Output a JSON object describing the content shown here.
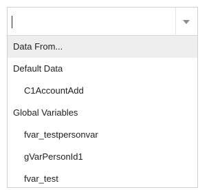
{
  "combobox": {
    "input_value": "",
    "items": [
      {
        "label": "Data From...",
        "level": 0,
        "highlighted": true
      },
      {
        "label": "Default Data",
        "level": 0,
        "highlighted": false
      },
      {
        "label": "C1AccountAdd",
        "level": 1,
        "highlighted": false
      },
      {
        "label": "Global Variables",
        "level": 0,
        "highlighted": false
      },
      {
        "label": "fvar_testpersonvar",
        "level": 1,
        "highlighted": false
      },
      {
        "label": "gVarPersonId1",
        "level": 1,
        "highlighted": false
      },
      {
        "label": "fvar_test",
        "level": 1,
        "highlighted": false
      }
    ]
  },
  "colors": {
    "highlight_bg": "#eeeeee",
    "border": "#cfcfcf",
    "text": "#222222",
    "arrow": "#8c8c8c"
  },
  "icons": {
    "toggle": "chevron-down-icon"
  }
}
